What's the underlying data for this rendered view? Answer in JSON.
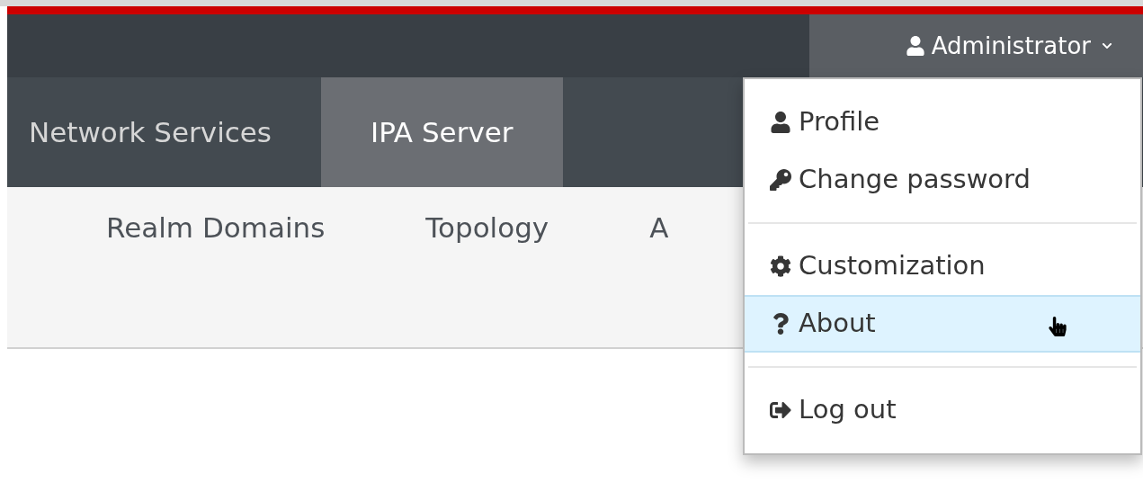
{
  "user_menu": {
    "label": "Administrator"
  },
  "nav_tabs": [
    {
      "label": "Network Services",
      "selected": false
    },
    {
      "label": "IPA Server",
      "selected": true
    }
  ],
  "sub_tabs": [
    {
      "label": "Realm Domains"
    },
    {
      "label": "Topology"
    },
    {
      "label": "A"
    }
  ],
  "dropdown": [
    {
      "kind": "profile",
      "label": "Profile",
      "highlighted": false
    },
    {
      "kind": "password",
      "label": "Change password",
      "highlighted": false
    },
    {
      "kind": "divider"
    },
    {
      "kind": "customization",
      "label": "Customization",
      "highlighted": false
    },
    {
      "kind": "about",
      "label": "About",
      "highlighted": true
    },
    {
      "kind": "divider"
    },
    {
      "kind": "logout",
      "label": "Log out",
      "highlighted": false
    }
  ]
}
